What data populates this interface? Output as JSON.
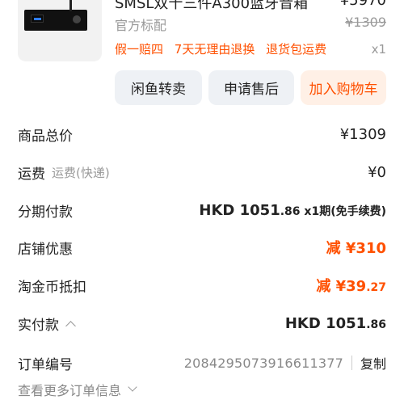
{
  "product": {
    "title": "SMSL双十三件A300蓝牙音箱",
    "orig_price": "¥5970",
    "spec": "官方标配",
    "spec_price": "¥1309",
    "tags": [
      "假一赔四",
      "7天无理由退换",
      "退货包运费"
    ],
    "qty": "x1"
  },
  "actions": {
    "resale": "闲鱼转卖",
    "aftersale": "申请售后",
    "cart": "加入购物车"
  },
  "summary": {
    "total_label": "商品总价",
    "total_value": "¥1309",
    "shipping_label": "运费",
    "shipping_sub": "运费(快递)",
    "shipping_value": "¥0",
    "install_label": "分期付款",
    "install_currency": "HKD ",
    "install_int": "1051",
    "install_dec": ".86",
    "install_suffix": " x1期(免手续费)",
    "shop_label": "店铺优惠",
    "shop_value": "减 ¥310",
    "coin_label": "淘金币抵扣",
    "coin_prefix": "减 ¥39",
    "coin_dec": ".27",
    "paid_label": "实付款",
    "paid_currency": "HKD ",
    "paid_int": "1051",
    "paid_dec": ".86",
    "order_label": "订单编号",
    "order_id": "2084295073916611377",
    "copy": "复制",
    "more": "查看更多订单信息"
  }
}
